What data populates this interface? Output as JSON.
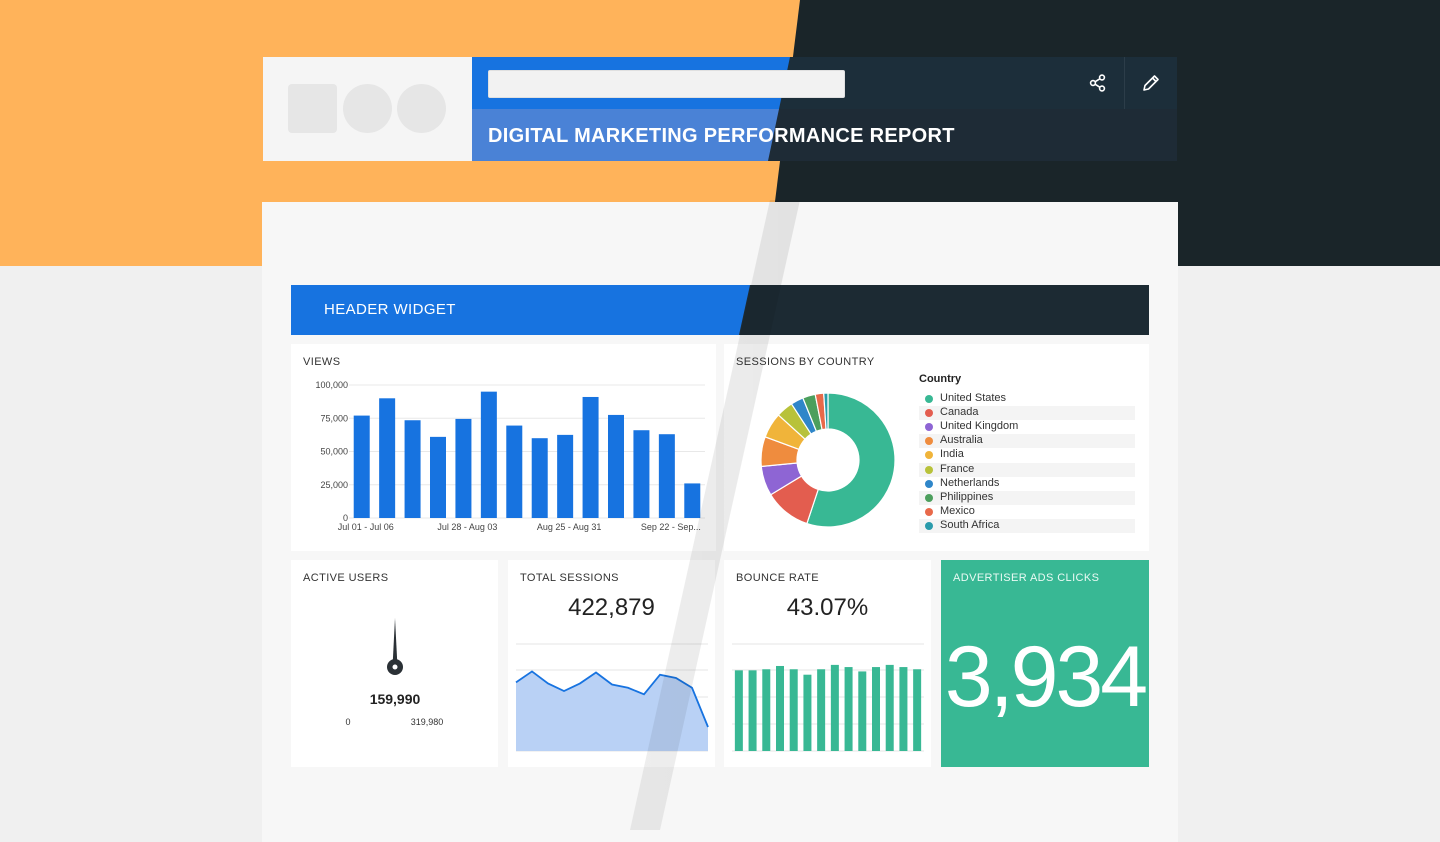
{
  "report": {
    "title": "DIGITAL MARKETING PERFORMANCE REPORT"
  },
  "toolbar": {
    "share_icon": "share-icon",
    "edit_icon": "pencil-icon"
  },
  "header_widget": {
    "label": "HEADER WIDGET"
  },
  "views": {
    "title": "VIEWS",
    "chart_data": {
      "type": "bar",
      "categories": [
        "Jul 01 - Jul 06",
        "",
        "",
        "",
        "Jul 28 - Aug 03",
        "",
        "",
        "",
        "Aug 25 - Aug 31",
        "",
        "",
        "",
        "Sep 22 - Sep..."
      ],
      "values": [
        77000,
        90000,
        73500,
        61000,
        74500,
        95000,
        69500,
        60000,
        62500,
        91000,
        77500,
        66000,
        63000,
        26000
      ],
      "ylim": [
        0,
        100000
      ],
      "yticks": [
        "0",
        "25,000",
        "50,000",
        "75,000",
        "100,000"
      ],
      "xtick_labels": [
        "Jul 01 - Jul 06",
        "Jul 28 - Aug 03",
        "Aug 25 - Aug 31",
        "Sep 22 - Sep..."
      ],
      "color": "#1773e0"
    }
  },
  "sessions_by_country": {
    "title": "SESSIONS BY COUNTRY",
    "legend_title": "Country",
    "chart_data": {
      "type": "pie",
      "labels": [
        "United States",
        "Canada",
        "United Kingdom",
        "Australia",
        "India",
        "France",
        "Netherlands",
        "Philippines",
        "Mexico",
        "South Africa"
      ],
      "values": [
        54,
        11,
        7,
        7,
        6,
        4,
        3,
        3,
        2,
        1
      ],
      "colors": [
        "#38b894",
        "#e35d4f",
        "#8e65d4",
        "#ef8c3e",
        "#f0b43a",
        "#b8c23a",
        "#2f86c9",
        "#4c9f5d",
        "#e8694a",
        "#2a9bab"
      ]
    }
  },
  "active_users": {
    "title": "ACTIVE USERS",
    "value": "159,990",
    "min_label": "0",
    "max_label": "319,980",
    "fraction": 0.5
  },
  "total_sessions": {
    "title": "TOTAL SESSIONS",
    "value": "422,879",
    "chart_data": {
      "type": "area",
      "values": [
        63,
        73,
        62,
        55,
        62,
        72,
        61,
        58,
        52,
        70,
        67,
        58,
        22
      ],
      "ylim": [
        0,
        100
      ]
    }
  },
  "bounce_rate": {
    "title": "BOUNCE RATE",
    "value": "43.07%",
    "chart_data": {
      "type": "bar",
      "values": [
        74,
        74,
        75,
        78,
        75,
        70,
        75,
        79,
        77,
        73,
        77,
        79,
        77,
        75
      ],
      "ylim": [
        0,
        100
      ],
      "color": "#38b894"
    }
  },
  "advertiser_ads_clicks": {
    "title": "ADVERTISER ADS CLICKS",
    "value": "3,934"
  }
}
